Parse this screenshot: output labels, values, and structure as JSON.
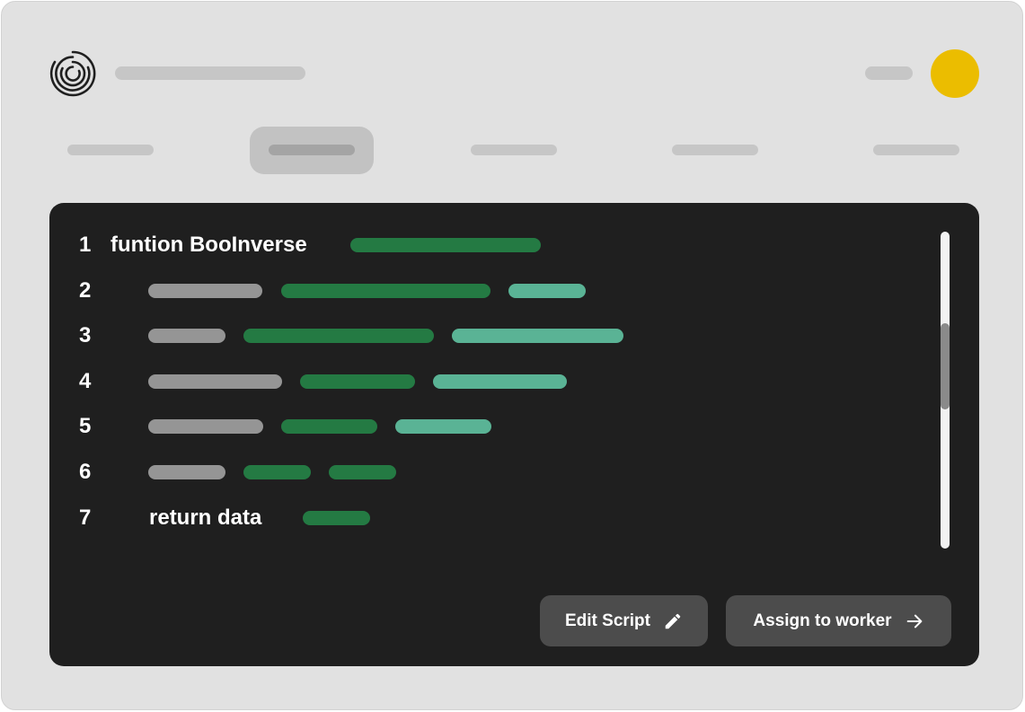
{
  "header": {
    "logo_icon": "concentric-rings-logo",
    "avatar_color": "#ebbd00"
  },
  "tabs": [
    {
      "id": "tab-1",
      "active": false
    },
    {
      "id": "tab-2",
      "active": true
    },
    {
      "id": "tab-3",
      "active": false
    },
    {
      "id": "tab-4",
      "active": false
    },
    {
      "id": "tab-5",
      "active": false
    }
  ],
  "editor": {
    "colors": {
      "background": "#1f1f1f",
      "token_gray": "#959595",
      "token_green": "#247a43",
      "token_teal": "#5ab395"
    },
    "lines": [
      {
        "number": "1",
        "text": "funtion BooInverse"
      },
      {
        "number": "2",
        "text": ""
      },
      {
        "number": "3",
        "text": ""
      },
      {
        "number": "4",
        "text": ""
      },
      {
        "number": "5",
        "text": ""
      },
      {
        "number": "6",
        "text": ""
      },
      {
        "number": "7",
        "text": "return data"
      }
    ]
  },
  "actions": {
    "edit_script_label": "Edit Script",
    "edit_icon": "pencil-icon",
    "assign_label": "Assign to worker",
    "assign_icon": "arrow-right-icon"
  }
}
